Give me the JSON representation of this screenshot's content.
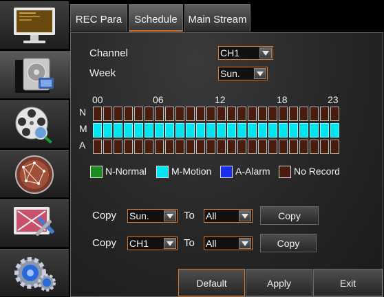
{
  "sidebar": {
    "items": [
      {
        "name": "display",
        "icon": "monitor-icon",
        "active": false
      },
      {
        "name": "record",
        "icon": "hard-disk-icon",
        "active": true
      },
      {
        "name": "search",
        "icon": "film-reel-search-icon",
        "active": false
      },
      {
        "name": "network",
        "icon": "network-globe-icon",
        "active": false
      },
      {
        "name": "advanced",
        "icon": "tools-icon",
        "active": false
      },
      {
        "name": "system",
        "icon": "gears-icon",
        "active": false
      }
    ]
  },
  "tabs": [
    {
      "label": "REC Para",
      "active": false
    },
    {
      "label": "Schedule",
      "active": true
    },
    {
      "label": "Main Stream",
      "active": false
    }
  ],
  "form": {
    "channel_label": "Channel",
    "channel_value": "CH1",
    "week_label": "Week",
    "week_value": "Sun."
  },
  "schedule": {
    "hour_labels": [
      "00",
      "06",
      "12",
      "18",
      "23"
    ],
    "row_labels": [
      "N",
      "M",
      "A"
    ],
    "hours": 24,
    "normal": [
      0,
      0,
      0,
      0,
      0,
      0,
      0,
      0,
      0,
      0,
      0,
      0,
      0,
      0,
      0,
      0,
      0,
      0,
      0,
      0,
      0,
      0,
      0,
      0
    ],
    "motion": [
      1,
      1,
      1,
      1,
      1,
      1,
      1,
      1,
      1,
      1,
      1,
      1,
      1,
      1,
      1,
      1,
      1,
      1,
      1,
      1,
      1,
      1,
      1,
      1
    ],
    "alarm": [
      0,
      0,
      0,
      0,
      0,
      0,
      0,
      0,
      0,
      0,
      0,
      0,
      0,
      0,
      0,
      0,
      0,
      0,
      0,
      0,
      0,
      0,
      0,
      0
    ]
  },
  "legend": [
    {
      "label": "N-Normal",
      "color": "#1f8a1f"
    },
    {
      "label": "M-Motion",
      "color": "#00e6f0"
    },
    {
      "label": "A-Alarm",
      "color": "#1a2ff0"
    },
    {
      "label": "No Record",
      "color": "#4a1c0e"
    }
  ],
  "copy_rows": [
    {
      "label": "Copy",
      "from": "Sun.",
      "to_label": "To",
      "to": "All",
      "button": "Copy"
    },
    {
      "label": "Copy",
      "from": "CH1",
      "to_label": "To",
      "to": "All",
      "button": "Copy"
    }
  ],
  "actions": {
    "default_label": "Default",
    "apply_label": "Apply",
    "exit_label": "Exit"
  },
  "colors": {
    "accent": "#e07a2a",
    "motion": "#00e6f0",
    "no_record": "#4a1c0e"
  }
}
